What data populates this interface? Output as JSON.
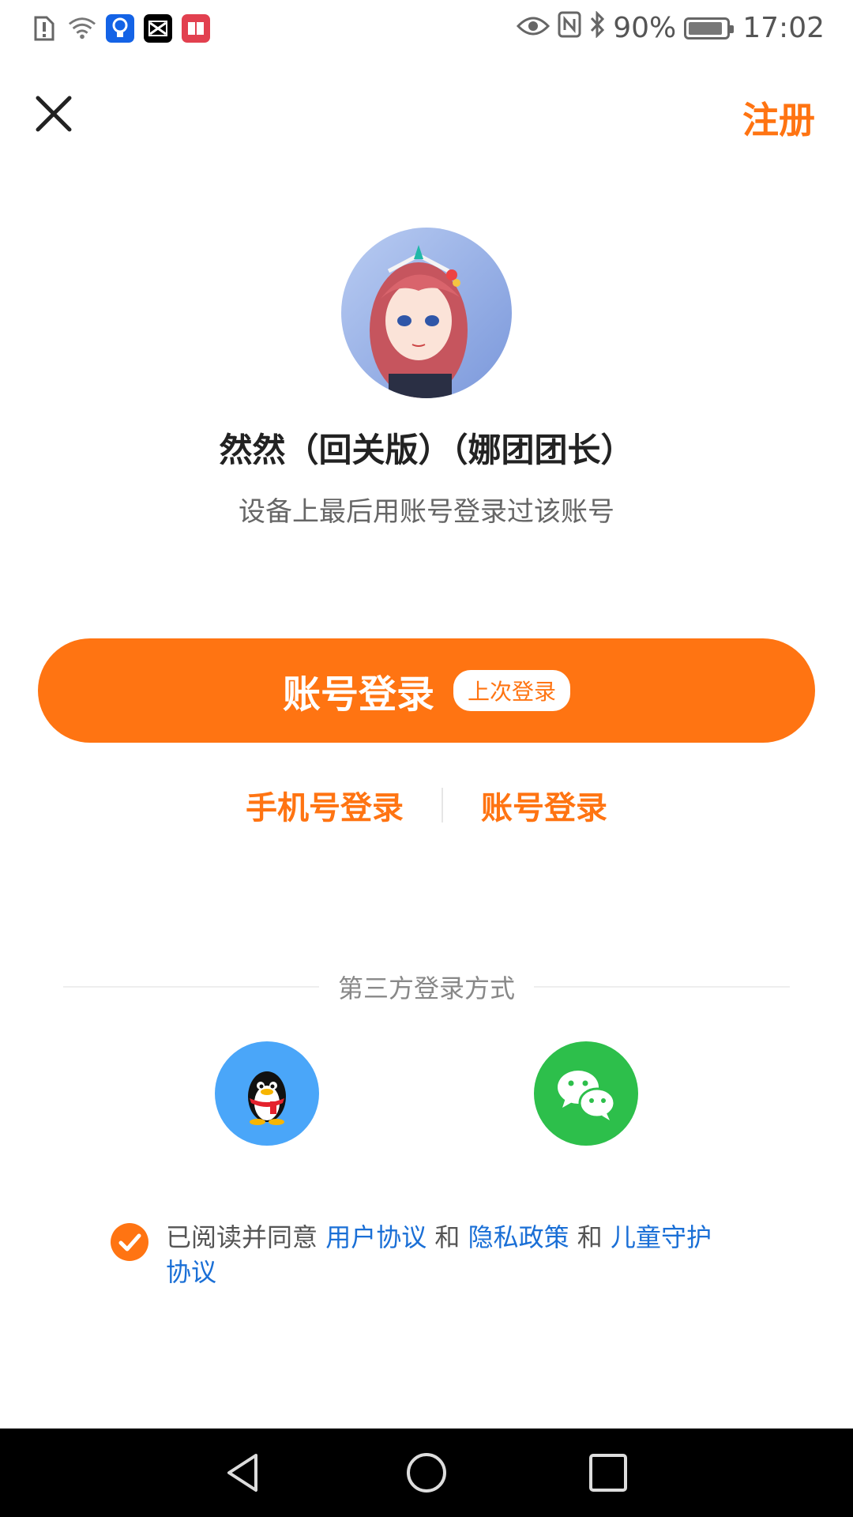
{
  "status_bar": {
    "battery": "90%",
    "battery_level": 0.9,
    "time": "17:02"
  },
  "header": {
    "close_icon": "close-icon",
    "register_label": "注册"
  },
  "profile": {
    "username": "然然（回关版）（娜团团长）",
    "subtitle": "设备上最后用账号登录过该账号"
  },
  "primary_login": {
    "label": "账号登录",
    "badge": "上次登录"
  },
  "alt_logins": {
    "phone_label": "手机号登录",
    "account_label": "账号登录"
  },
  "third_party": {
    "title": "第三方登录方式",
    "qq_icon": "qq-penguin-icon",
    "wechat_icon": "wechat-icon"
  },
  "agreement": {
    "prefix": "已阅读并同意",
    "user_agreement": "用户协议",
    "and1": "和",
    "privacy_policy": "隐私政策",
    "and2": "和",
    "child_protection": "儿童守护协议",
    "checked": true
  },
  "colors": {
    "accent": "#ff7412",
    "link": "#1a6fd6",
    "qq": "#4aa6f9",
    "wechat": "#2dbf4b"
  }
}
